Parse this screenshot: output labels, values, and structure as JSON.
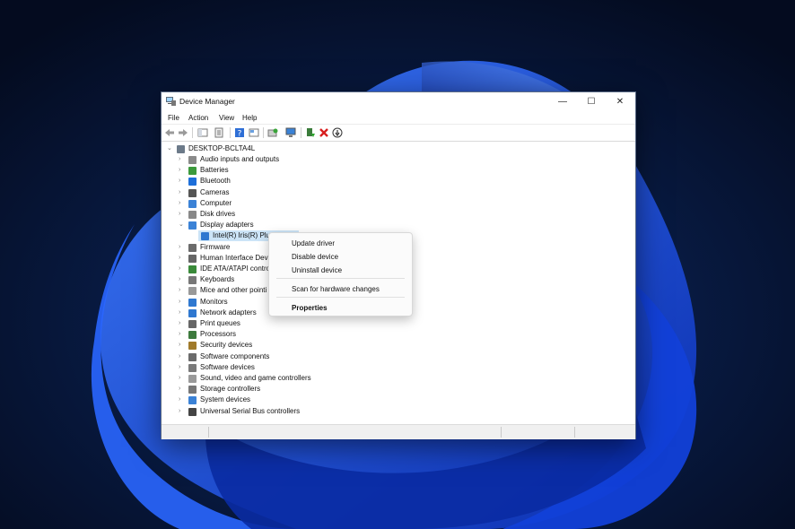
{
  "window": {
    "title": "Device Manager",
    "controls": {
      "minimize": "—",
      "maximize": "☐",
      "close": "✕"
    }
  },
  "menu": [
    "File",
    "Action",
    "View",
    "Help"
  ],
  "toolbar_icons": [
    "back-icon",
    "forward-icon",
    "show-hide-tree-icon",
    "properties-icon",
    "help-icon",
    "view-icon",
    "scan-icon",
    "monitor-icon",
    "update-driver-icon",
    "uninstall-icon",
    "disable-icon"
  ],
  "tree": {
    "root": "DESKTOP-BCLTA4L",
    "categories": [
      {
        "label": "Audio inputs and outputs",
        "icon": "speaker-icon"
      },
      {
        "label": "Batteries",
        "icon": "battery-icon"
      },
      {
        "label": "Bluetooth",
        "icon": "bluetooth-icon"
      },
      {
        "label": "Cameras",
        "icon": "camera-icon"
      },
      {
        "label": "Computer",
        "icon": "computer-icon"
      },
      {
        "label": "Disk drives",
        "icon": "disk-icon"
      },
      {
        "label": "Display adapters",
        "icon": "display-icon",
        "expanded": true
      },
      {
        "label": "Firmware",
        "icon": "chip-icon"
      },
      {
        "label": "Human Interface Devic",
        "icon": "hid-icon"
      },
      {
        "label": "IDE ATA/ATAPI controll",
        "icon": "ide-icon"
      },
      {
        "label": "Keyboards",
        "icon": "keyboard-icon"
      },
      {
        "label": "Mice and other pointi",
        "icon": "mouse-icon"
      },
      {
        "label": "Monitors",
        "icon": "monitor-icon"
      },
      {
        "label": "Network adapters",
        "icon": "network-icon"
      },
      {
        "label": "Print queues",
        "icon": "printer-icon"
      },
      {
        "label": "Processors",
        "icon": "cpu-icon"
      },
      {
        "label": "Security devices",
        "icon": "security-icon"
      },
      {
        "label": "Software components",
        "icon": "component-icon"
      },
      {
        "label": "Software devices",
        "icon": "software-icon"
      },
      {
        "label": "Sound, video and game controllers",
        "icon": "sound-icon"
      },
      {
        "label": "Storage controllers",
        "icon": "storage-icon"
      },
      {
        "label": "System devices",
        "icon": "system-icon"
      },
      {
        "label": "Universal Serial Bus controllers",
        "icon": "usb-icon"
      }
    ],
    "child": {
      "label": "Intel(R) Iris(R) Plus G",
      "icon": "display-adapter-icon"
    }
  },
  "context_menu": {
    "items": [
      "Update driver",
      "Disable device",
      "Uninstall device",
      "Scan for hardware changes",
      "Properties"
    ]
  },
  "colors": {
    "selection": "#cce4f7",
    "wallpaper_bg": "#071330",
    "bloom": "#1f5bff"
  }
}
